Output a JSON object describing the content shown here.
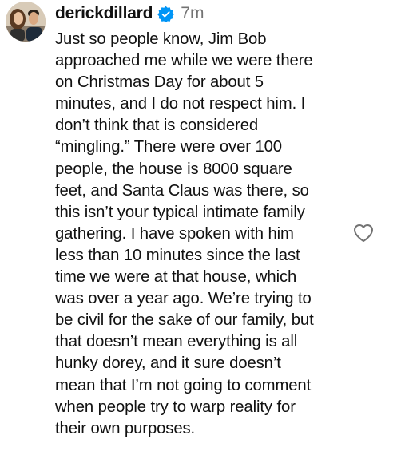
{
  "comment": {
    "username": "derickdillard",
    "verified_icon": "verified-badge-icon",
    "timestamp": "7m",
    "lines": [
      "Just so people know, Jim Bob",
      "approached me while we were there",
      "on Christmas Day for about 5",
      "minutes, and I do not respect him. I",
      "don’t think that is considered",
      "“mingling.” There were over 100",
      "people, the house is 8000 square",
      "feet, and Santa Claus was there, so",
      "this isn’t your typical intimate family",
      "gathering. I have spoken with him",
      "less than 10 minutes since the last",
      "time we were at that house, which",
      "was over a year ago. We’re trying to",
      "be civil for the sake of our family, but",
      "that doesn’t mean everything is all",
      "hunky dorey, and it sure doesn’t",
      "mean that I’m not going to comment",
      "when people try to warp reality for",
      "their own purposes."
    ],
    "like_icon": "heart-outline-icon"
  },
  "colors": {
    "text": "#111111",
    "muted": "#737373",
    "verified": "#0095f6"
  }
}
